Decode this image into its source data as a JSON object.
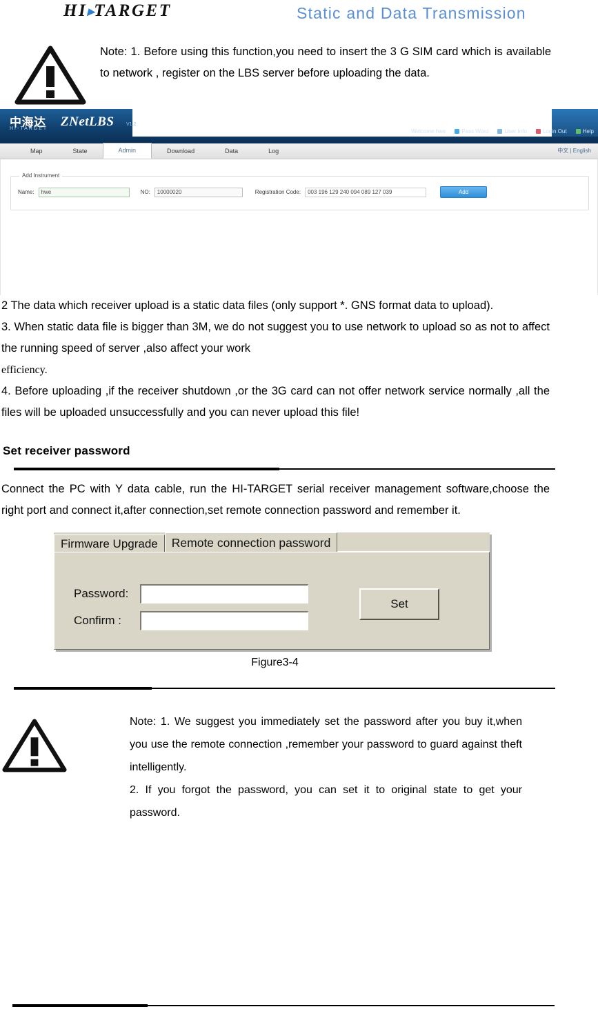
{
  "header": {
    "logo_text": "HI",
    "logo_text_2": "TARGET",
    "logo_separator": "▸",
    "title": "Static and Data Transmission"
  },
  "note_top": {
    "icon": "warning-triangle-icon",
    "text": "Note: 1. Before using this function,you need to insert the 3 G SIM card which is available to network , register on the LBS server before uploading the data."
  },
  "znetlbs_screenshot": {
    "logo_cn": "中海达",
    "logo_cn_sub": "HI-TARGET",
    "product": "ZNetLBS",
    "version": "V1.2",
    "user_menu": [
      {
        "label": "Welcome hwe",
        "icon": ""
      },
      {
        "label": "Pass Word",
        "icon": "key-icon"
      },
      {
        "label": "User Info",
        "icon": "user-icon"
      },
      {
        "label": "Login Out",
        "icon": "logout-icon"
      },
      {
        "label": "Help",
        "icon": "help-icon"
      }
    ],
    "tabs": [
      {
        "label": "Map",
        "active": false
      },
      {
        "label": "State",
        "active": false
      },
      {
        "label": "Admin",
        "active": true
      },
      {
        "label": "Download",
        "active": false
      },
      {
        "label": "Data",
        "active": false
      },
      {
        "label": "Log",
        "active": false
      }
    ],
    "language_switch": "中文 | English",
    "fieldset_legend": "Add Instrument",
    "form": {
      "name_label": "Name:",
      "name_value": "hwe",
      "no_label": "NO:",
      "no_value": "10000020",
      "reg_label": "Registration Code:",
      "reg_value": "003 196 129 240 094 089 127 039",
      "add_button": "Add"
    }
  },
  "body": {
    "para_2": "2 The data which receiver upload is a static data files (only support *. GNS format data to upload).",
    "para_3a": "3. When static data file is bigger than 3M, we do not suggest you to use network to upload so as not to affect the running speed of server ,also affect your work",
    "para_3b": "efficiency.",
    "para_4": "4. Before uploading ,if the receiver shutdown ,or the 3G card can not offer network service normally ,all the files will be uploaded unsuccessfully and you can never upload this file!"
  },
  "section": {
    "heading": "Set receiver password",
    "paragraph": "Connect the PC with Y data cable, run the HI-TARGET serial receiver management software,choose the right port and connect it,after connection,set remote connection password and remember it."
  },
  "dialog": {
    "tabs": [
      {
        "label": "Firmware Upgrade",
        "active": false
      },
      {
        "label": "Remote connection password",
        "active": true
      }
    ],
    "password_label": "Password:",
    "password_value": "",
    "confirm_label": "Confirm :",
    "confirm_value": "",
    "set_button": "Set"
  },
  "figure_caption": "Figure3-4",
  "note_bottom": {
    "icon": "warning-triangle-icon",
    "line_1": "Note: 1. We suggest you immediately set the password after you buy it,when you use the remote connection ,remember your password to guard against theft intelligently.",
    "line_2": "2. If you forgot the password, you can set it to original state to get your password."
  },
  "colors": {
    "header_title": "#5b8fd4",
    "znet_bar": "#10406e",
    "znet_button": "#2f8fd8",
    "dialog_face": "#d9d6c8"
  }
}
